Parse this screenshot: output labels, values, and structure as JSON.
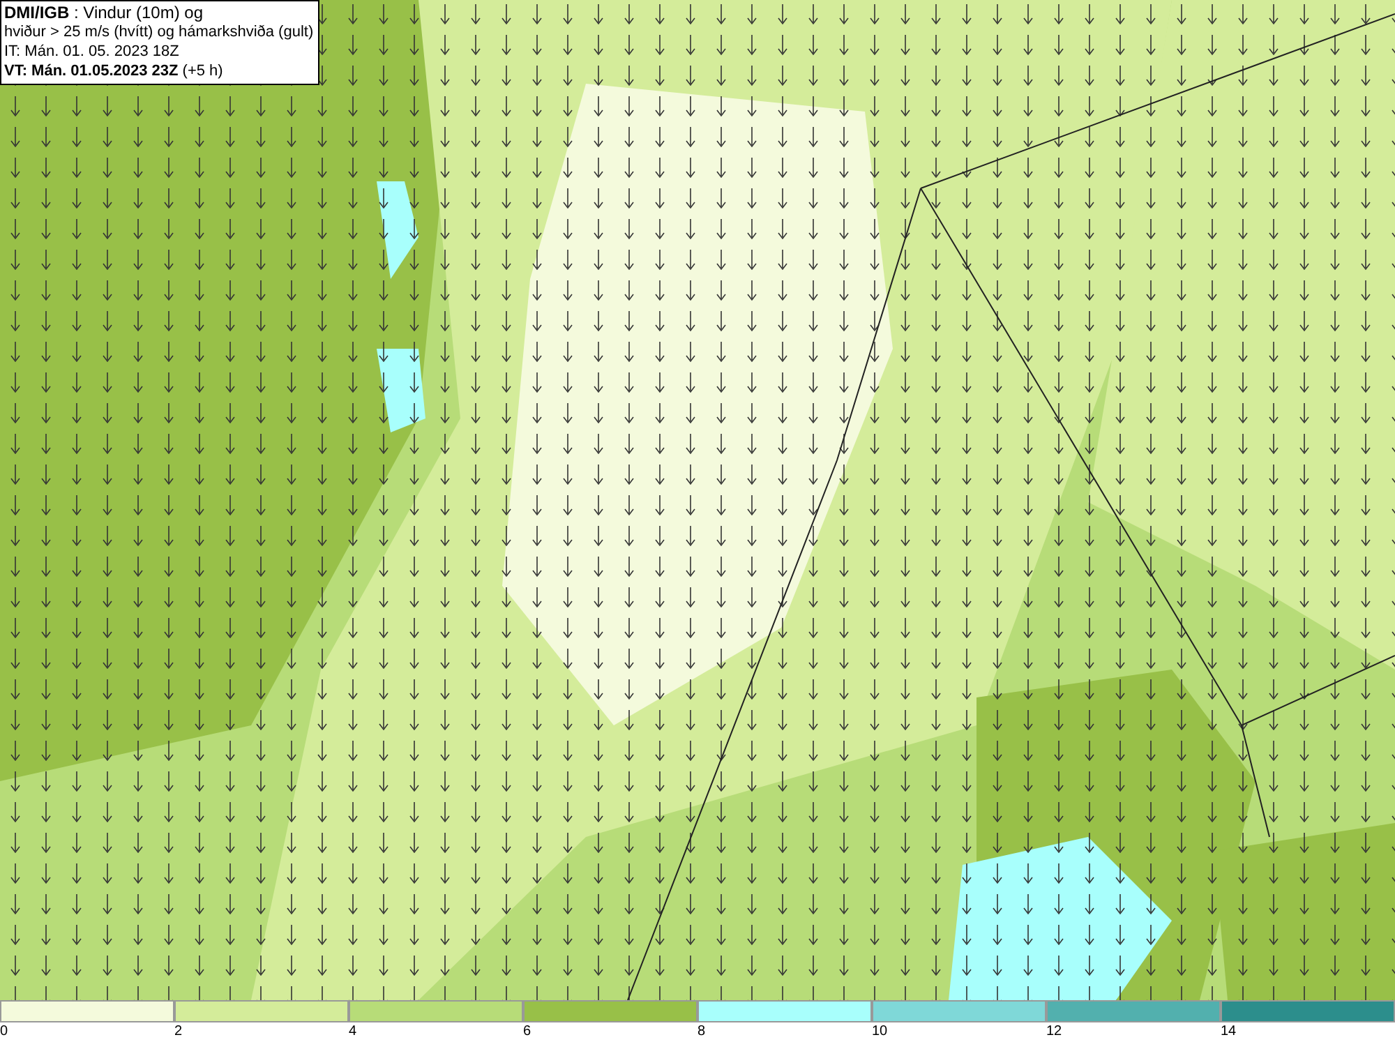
{
  "info_box": {
    "lines": [
      "**DMI/IGB** : Vindur (10m) og",
      "hviður > 25 m/s (hvítt) og hámarkshviða (gult)",
      "IT: Mán. 01. 05. 2023 18Z",
      "**VT: Mán. 01.05.2023 23Z** (+5 h)"
    ]
  },
  "legend": {
    "items": [
      {
        "label": "0",
        "color": "#f4fadc"
      },
      {
        "label": "2",
        "color": "#d4ec9a"
      },
      {
        "label": "4",
        "color": "#b7dc78"
      },
      {
        "label": "6",
        "color": "#98c048"
      },
      {
        "label": "8",
        "color": "#a8fffc"
      },
      {
        "label": "10",
        "color": "#7fd8d8"
      },
      {
        "label": "12",
        "color": "#52b0ae"
      },
      {
        "label": "14",
        "color": "#2c8e8c"
      }
    ]
  }
}
